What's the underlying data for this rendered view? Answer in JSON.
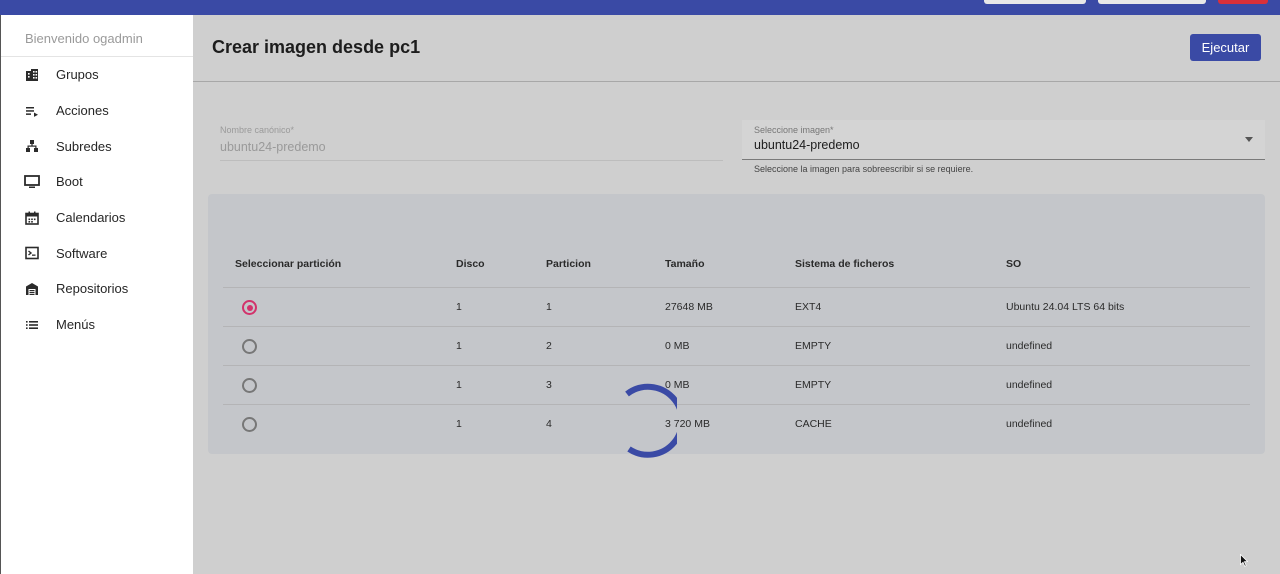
{
  "sidebar": {
    "welcome": "Bienvenido ogadmin",
    "items": [
      {
        "label": "Grupos",
        "icon": "building-icon"
      },
      {
        "label": "Acciones",
        "icon": "playlist-icon"
      },
      {
        "label": "Subredes",
        "icon": "network-tree-icon"
      },
      {
        "label": "Boot",
        "icon": "monitor-icon"
      },
      {
        "label": "Calendarios",
        "icon": "calendar-icon"
      },
      {
        "label": "Software",
        "icon": "terminal-icon"
      },
      {
        "label": "Repositorios",
        "icon": "warehouse-icon"
      },
      {
        "label": "Menús",
        "icon": "list-icon"
      }
    ]
  },
  "header": {
    "title": "Crear imagen desde pc1",
    "execute_label": "Ejecutar"
  },
  "form": {
    "canonical": {
      "label": "Nombre canónico*",
      "value": "ubuntu24-predemo"
    },
    "image_select": {
      "label": "Seleccione imagen*",
      "value": "ubuntu24-predemo",
      "hint": "Seleccione la imagen para sobreescribir si se requiere."
    }
  },
  "table": {
    "headers": [
      "Seleccionar partición",
      "Disco",
      "Particion",
      "Tamaño",
      "Sistema de ficheros",
      "SO"
    ],
    "rows": [
      {
        "selected": true,
        "disk": "1",
        "partition": "1",
        "size": "27648 MB",
        "fs": "EXT4",
        "os": "Ubuntu 24.04 LTS 64 bits"
      },
      {
        "selected": false,
        "disk": "1",
        "partition": "2",
        "size": "0 MB",
        "fs": "EMPTY",
        "os": "undefined"
      },
      {
        "selected": false,
        "disk": "1",
        "partition": "3",
        "size": "0 MB",
        "fs": "EMPTY",
        "os": "undefined"
      },
      {
        "selected": false,
        "disk": "1",
        "partition": "4",
        "size": "3 720 MB",
        "fs": "CACHE",
        "os": "undefined"
      }
    ]
  },
  "colors": {
    "primary": "#3a4aa5",
    "radio_selected": "#d2326b",
    "danger": "#d9303a"
  }
}
